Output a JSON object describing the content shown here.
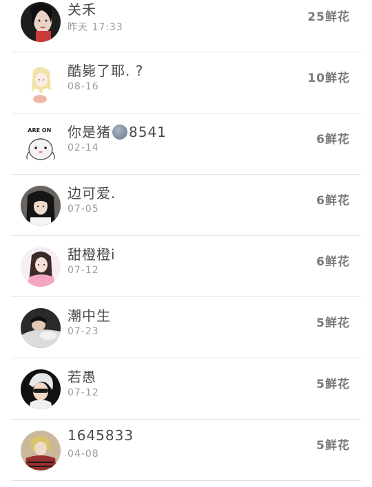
{
  "list": {
    "items": [
      {
        "name": "关禾",
        "time": "昨天 17:33",
        "flowers": "25鲜花"
      },
      {
        "name": "酷毙了耶. ?",
        "time": "08-16",
        "flowers": "10鲜花"
      },
      {
        "name_prefix": "你是猪",
        "name_suffix": "8541",
        "time": "02-14",
        "flowers": "6鲜花",
        "avatar_text": "E ARE ON"
      },
      {
        "name": "边可爱.",
        "time": "07-05",
        "flowers": "6鲜花"
      },
      {
        "name": "甜橙橙i",
        "time": "07-12",
        "flowers": "6鲜花"
      },
      {
        "name": "潮中生",
        "time": "07-23",
        "flowers": "5鲜花"
      },
      {
        "name": "若愚",
        "time": "07-12",
        "flowers": "5鲜花"
      },
      {
        "name": "1645833",
        "time": "04-08",
        "flowers": "5鲜花"
      }
    ]
  }
}
